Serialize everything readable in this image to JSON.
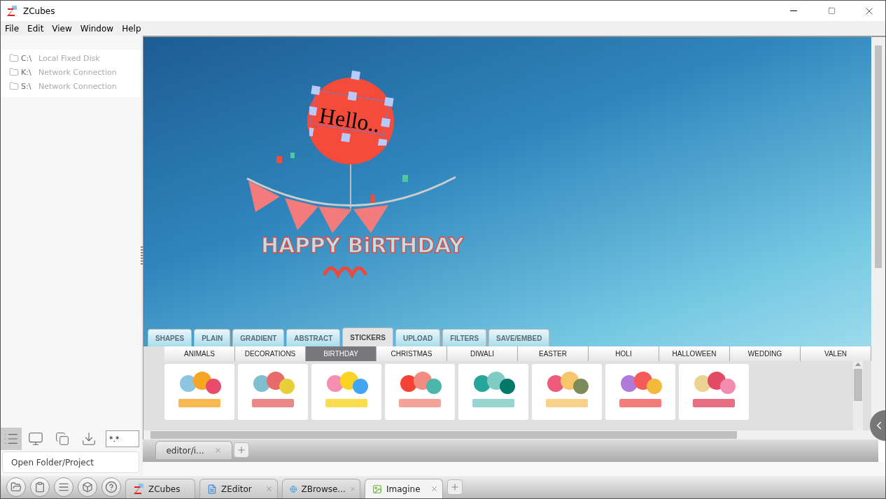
{
  "window": {
    "title": "ZCubes"
  },
  "menu": [
    "File",
    "Edit",
    "View",
    "Window",
    "Help"
  ],
  "drives": [
    {
      "letter": "C:\\",
      "description": "Local Fixed Disk"
    },
    {
      "letter": "K:\\",
      "description": "Network Connection"
    },
    {
      "letter": "S:\\",
      "description": "Network Connection"
    }
  ],
  "file_filter": {
    "value": "*.*"
  },
  "open_folder_label": "Open Folder/Project",
  "canvas": {
    "text_object": "Hello..",
    "banner_text": "HAPPY BiRTHDAY"
  },
  "panel_tabs": [
    {
      "label": "SHAPES",
      "selected": false
    },
    {
      "label": "PLAIN",
      "selected": false
    },
    {
      "label": "GRADIENT",
      "selected": false
    },
    {
      "label": "ABSTRACT",
      "selected": false
    },
    {
      "label": "STICKERS",
      "selected": true
    },
    {
      "label": "UPLOAD",
      "selected": false
    },
    {
      "label": "FILTERS",
      "selected": false
    },
    {
      "label": "SAVE/EMBED",
      "selected": false
    }
  ],
  "sticker_categories": [
    {
      "label": "ANIMALS",
      "selected": false
    },
    {
      "label": "DECORATIONS",
      "selected": false
    },
    {
      "label": "BIRTHDAY",
      "selected": true
    },
    {
      "label": "CHRISTMAS",
      "selected": false
    },
    {
      "label": "DIWALI",
      "selected": false
    },
    {
      "label": "EASTER",
      "selected": false
    },
    {
      "label": "HOLI",
      "selected": false
    },
    {
      "label": "HALLOWEEN",
      "selected": false
    },
    {
      "label": "WEDDING",
      "selected": false
    },
    {
      "label": "VALEN",
      "selected": false
    }
  ],
  "stickers": [
    {
      "kind": "party-hats"
    },
    {
      "kind": "letters"
    },
    {
      "kind": "small-balloons"
    },
    {
      "kind": "bunting"
    },
    {
      "kind": "cake-teal"
    },
    {
      "kind": "cake-pink"
    },
    {
      "kind": "three-balloons"
    },
    {
      "kind": "ribbon-balloons"
    }
  ],
  "editor_tabs": [
    {
      "label": "editor/i..."
    }
  ],
  "taskbar_tabs": [
    {
      "label": "ZCubes",
      "selected": false
    },
    {
      "label": "ZEditor",
      "selected": false
    },
    {
      "label": "ZBrowse...",
      "selected": false
    },
    {
      "label": "Imagine",
      "selected": true
    }
  ]
}
